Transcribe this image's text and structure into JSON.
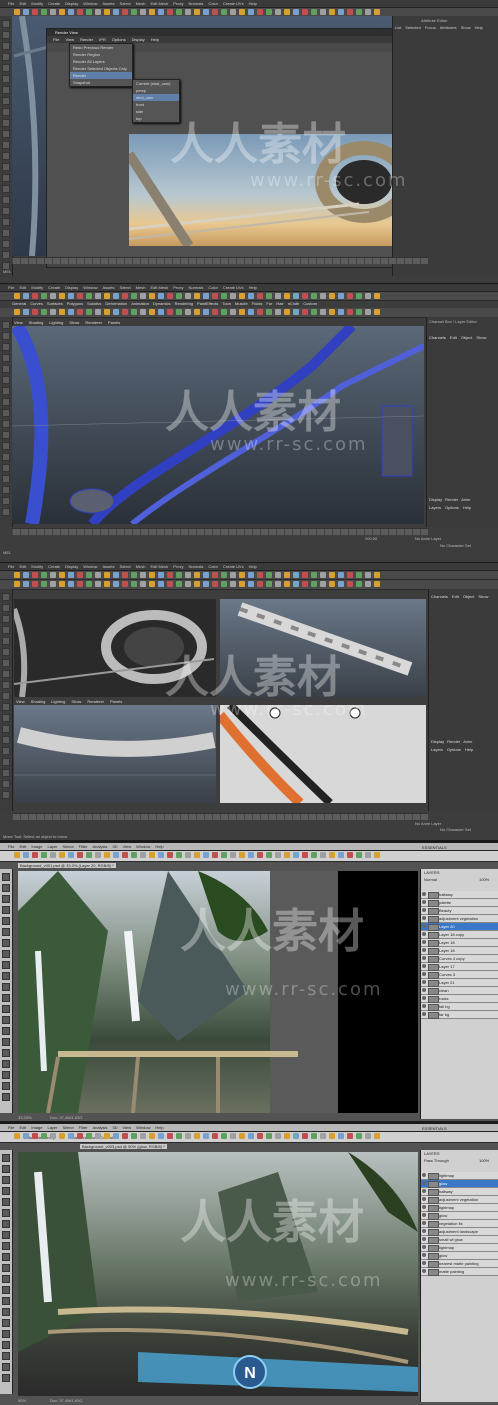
{
  "panel1": {
    "menu": [
      "File",
      "Edit",
      "Modify",
      "Create",
      "Display",
      "Window",
      "Assets",
      "Select",
      "Mesh",
      "Edit Mesh",
      "Proxy",
      "Normals",
      "Color",
      "Create UVs",
      "Help"
    ],
    "render_view": {
      "title": "Render View",
      "menu": [
        "File",
        "View",
        "Render",
        "IPR",
        "Options",
        "Display",
        "Help"
      ],
      "render_menu": [
        "Redo Previous Render",
        "Render Region",
        "Render All Layers",
        "Render Selected Objects Only",
        "Render",
        "Snapshot"
      ],
      "camera_menu": [
        "Current (shot_cam)",
        "persp",
        "shot_cam",
        "front",
        "side",
        "top"
      ],
      "bottom": [
        "1:1",
        "1.00"
      ]
    },
    "right_label": "Attribute Editor",
    "right_menu": [
      "List",
      "Selected",
      "Focus",
      "Attributes",
      "Show",
      "Help"
    ]
  },
  "panel2": {
    "menu": [
      "File",
      "Edit",
      "Modify",
      "Create",
      "Display",
      "Window",
      "Assets",
      "Select",
      "Mesh",
      "Edit Mesh",
      "Proxy",
      "Normals",
      "Color",
      "Create UVs",
      "Help"
    ],
    "shelf_tabs": [
      "General",
      "Curves",
      "Surfaces",
      "Polygons",
      "Subdivs",
      "Deformation",
      "Animation",
      "Dynamics",
      "Rendering",
      "PaintEffects",
      "Toon",
      "Muscle",
      "Fluids",
      "Fur",
      "Hair",
      "nCloth",
      "Custom"
    ],
    "view_menu": [
      "View",
      "Shading",
      "Lighting",
      "Show",
      "Renderer",
      "Panels"
    ],
    "channel_box": "Channel Box / Layer Editor",
    "channel_menu": [
      "Channels",
      "Edit",
      "Object",
      "Show"
    ],
    "layer_tabs": [
      "Display",
      "Render",
      "Anim"
    ],
    "layer_menu": [
      "Layers",
      "Options",
      "Help"
    ],
    "timeline_end": [
      "200.00",
      "200.00"
    ],
    "anim_layer": "No Anim Layer",
    "char_set": "No Character Set",
    "mel": "MEL"
  },
  "panel3": {
    "menu": [
      "File",
      "Edit",
      "Modify",
      "Create",
      "Display",
      "Window",
      "Assets",
      "Select",
      "Mesh",
      "Edit Mesh",
      "Proxy",
      "Normals",
      "Color",
      "Create UVs",
      "Help"
    ],
    "view_menu": [
      "View",
      "Shading",
      "Lighting",
      "Show",
      "Renderer",
      "Panels"
    ],
    "channel_menu": [
      "Channels",
      "Edit",
      "Object",
      "Show"
    ],
    "layer_tabs": [
      "Display",
      "Render",
      "Anim"
    ],
    "layer_menu": [
      "Layers",
      "Options",
      "Help"
    ],
    "anim_layer": "No Anim Layer",
    "char_set": "No Character Set",
    "help_line": "Move Tool: Select an object to move."
  },
  "panel4": {
    "menu": [
      "File",
      "Edit",
      "Image",
      "Layer",
      "Select",
      "Filter",
      "Analysis",
      "3D",
      "View",
      "Window",
      "Help"
    ],
    "workspace": "ESSENTIALS",
    "doc_tab": "Background_v001.psd @ 33.3% (Layer 20, RGB/8) *",
    "layers_title": "LAYERS",
    "blend": "Normal",
    "opacity": "100%",
    "layers": [
      "haltstay",
      "palette",
      "Beauty",
      "adjustment vegetation",
      "Layer 20",
      "Layer 18 copy",
      "Layer 18",
      "Layer 18",
      "Curves 4 copy",
      "Layer 17",
      "Curves 3",
      "Layer 21",
      "clean",
      "rocks",
      "fall bg",
      "far bg"
    ],
    "status": "33.33%",
    "doc_size": "Doc: 37.4M/1.63G"
  },
  "panel5": {
    "menu": [
      "File",
      "Edit",
      "Image",
      "Layer",
      "Select",
      "Filter",
      "Analysis",
      "3D",
      "View",
      "Window",
      "Help"
    ],
    "workspace": "ESSENTIALS",
    "doc_tab": "Background_v003.psd @ 50% (glow, RGB/8) *",
    "option": "Show Transform Controls",
    "auto_select": "Auto-Select:",
    "group": "Group",
    "layers_title": "LAYERS",
    "blend": "Pass Through",
    "opacity": "100%",
    "layers": [
      "lightmap",
      "glow",
      "haltway",
      "adjustment vegetation",
      "lightmap",
      "glow",
      "vegetation fix",
      "adjustment landscape",
      "small wf glow",
      "lightmap",
      "glow",
      "nearest matte painting",
      "matte painting"
    ],
    "status": "50%",
    "doc_size": "Doc: 37.4M/1.63G"
  },
  "watermark": {
    "cn": "人人素材",
    "url": "www.rr-sc.com"
  }
}
